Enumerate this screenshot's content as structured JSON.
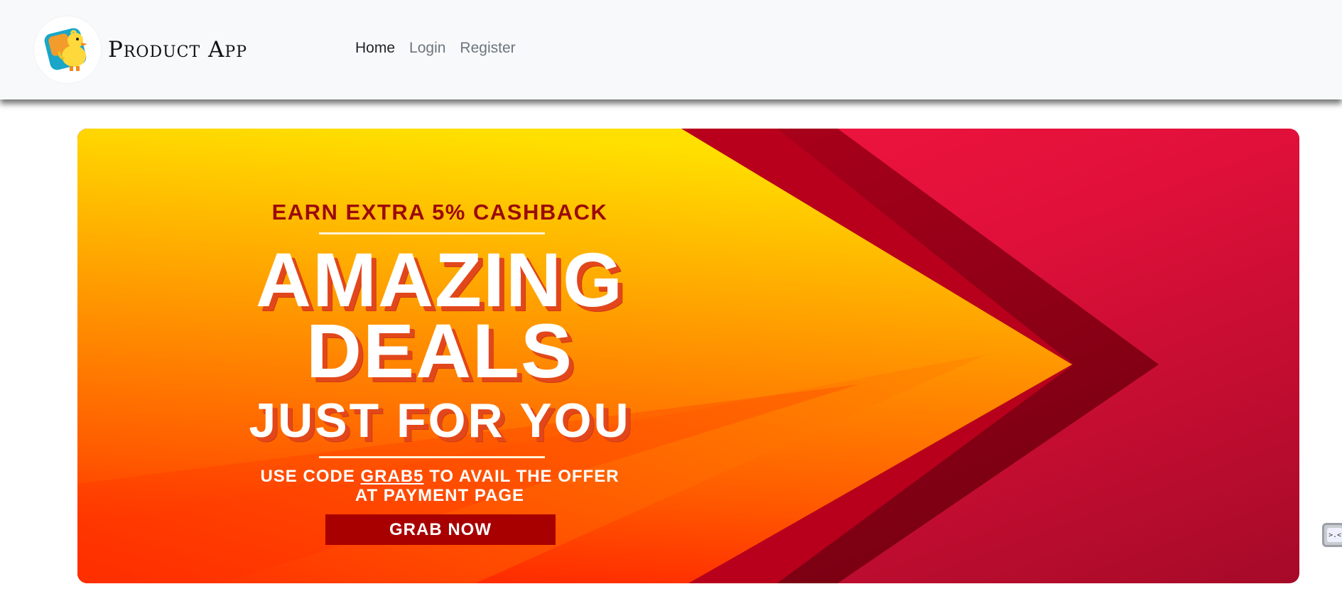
{
  "navbar": {
    "brand": {
      "name": "Product App",
      "logo_icon": "duck-logo-icon"
    },
    "links": [
      {
        "label": "Home",
        "active": true
      },
      {
        "label": "Login",
        "active": false
      },
      {
        "label": "Register",
        "active": false
      }
    ]
  },
  "banner": {
    "kicker": "EARN EXTRA 5% CASHBACK",
    "headline_line1": "AMAZING",
    "headline_line2": "DEALS",
    "headline_line3": "JUST FOR YOU",
    "code_prefix": "USE CODE",
    "code": "GRAB5",
    "code_suffix": "TO AVAIL THE OFFER",
    "code_line2": "AT PAYMENT PAGE",
    "cta_label": "GRAB NOW",
    "colors": {
      "orange": "#ff8a00",
      "yellow": "#ffe000",
      "red_orange": "#ff2a00",
      "crimson": "#e0103a",
      "dark_red": "#8a0010",
      "cta_bg": "#a80000"
    }
  },
  "floating_widget": {
    "icon": "chat-widget-icon",
    "text": ">.<"
  }
}
